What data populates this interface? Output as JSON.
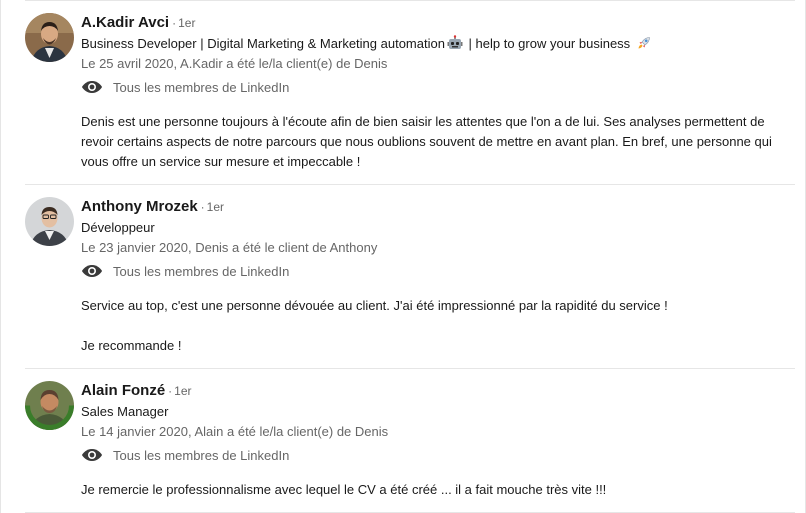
{
  "recommendations": [
    {
      "name": "A.Kadir Avci",
      "separator": "·",
      "degree": "1er",
      "headline_before": "Business Developer | Digital Marketing & Marketing automation",
      "headline_middle": " | help to grow your business ",
      "headline_icons": [
        "robot-emoji-icon",
        "rocket-emoji-icon"
      ],
      "date_relation": "Le 25 avril 2020, A.Kadir a été le/la client(e) de Denis",
      "visibility": "Tous les membres de LinkedIn",
      "text_paragraphs": [
        "Denis est une personne toujours à l'écoute afin de bien saisir les attentes que l'on a de lui. Ses analyses permettent de revoir certains aspects de notre parcours que nous oublions souvent de mettre en avant plan. En bref, une personne qui vous offre un service sur mesure et impeccable !"
      ]
    },
    {
      "name": "Anthony Mrozek",
      "separator": "·",
      "degree": "1er",
      "headline": "Développeur",
      "date_relation": "Le 23 janvier 2020, Denis a été le client de Anthony",
      "visibility": "Tous les membres de LinkedIn",
      "text_paragraphs": [
        "Service au top, c'est une personne dévouée au client. J'ai été impressionné par la rapidité du service !",
        "Je recommande !"
      ]
    },
    {
      "name": "Alain Fonzé",
      "separator": "·",
      "degree": "1er",
      "headline": "Sales Manager",
      "date_relation": "Le 14 janvier 2020, Alain a été le/la client(e) de Denis",
      "visibility": "Tous les membres de LinkedIn",
      "avatar_badge_text": "OPENTOWORK",
      "text_paragraphs": [
        "Je remercie le professionnalisme avec lequel le CV a été créé ... il a fait mouche très vite !!!"
      ]
    }
  ],
  "colors": {
    "text_primary": "#1f1f1f",
    "text_secondary": "#666666",
    "divider": "#e6e6e6",
    "opentowork_green": "#3a7d2a"
  },
  "icons": {
    "visibility": "eye-icon"
  }
}
